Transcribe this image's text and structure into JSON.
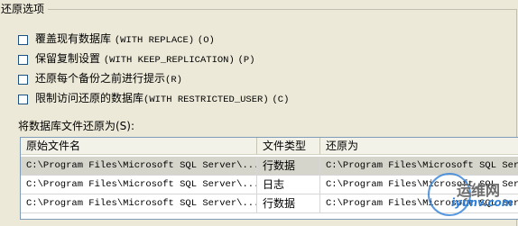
{
  "group": {
    "title": "还原选项"
  },
  "options": [
    {
      "text": "覆盖现有数据库",
      "code": "(WITH REPLACE)",
      "key": "(O)",
      "checked": false
    },
    {
      "text": "保留复制设置",
      "code": "(WITH KEEP_REPLICATION)",
      "key": "(P)",
      "checked": false
    },
    {
      "text": "还原每个备份之前进行提示",
      "code": "",
      "key": "(R)",
      "checked": false
    },
    {
      "text": "限制访问还原的数据库",
      "code": "(WITH RESTRICTED_USER)",
      "key": "(C)",
      "checked": false
    }
  ],
  "restore_files_label": "将数据库文件还原为(S):",
  "table": {
    "columns": [
      "原始文件名",
      "文件类型",
      "还原为"
    ],
    "rows": [
      [
        "C:\\Program Files\\Microsoft SQL Server\\...",
        "行数据",
        "C:\\Program Files\\Microsoft SQL Server"
      ],
      [
        "C:\\Program Files\\Microsoft SQL Server\\...",
        "日志",
        "C:\\Program Files\\Microsoft SQL Server"
      ],
      [
        "C:\\Program Files\\Microsoft SQL Server\\...",
        "行数据",
        "C:\\Program Files\\Microsoft SQL Server"
      ]
    ],
    "selected_row": 0
  },
  "watermark": {
    "line1": "运维网",
    "line2": "iyunv.com"
  }
}
